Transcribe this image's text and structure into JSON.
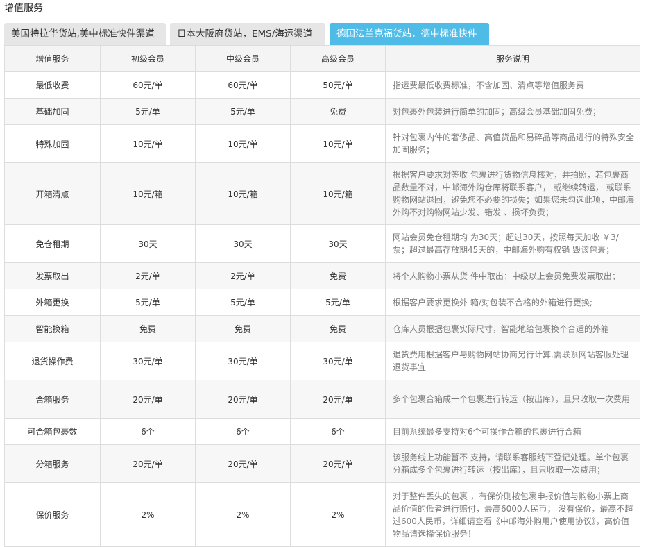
{
  "section": {
    "title": "增值服务"
  },
  "tabs": [
    {
      "label": "美国特拉华货站,美中标准快件渠道",
      "active": false
    },
    {
      "label": "日本大阪府货站，EMS/海运渠道",
      "active": false
    },
    {
      "label": "德国法兰克福货站，德中标准快件",
      "active": true
    }
  ],
  "colors": {
    "tab_active": "#4fbbe7",
    "tab_inactive": "#e6e6e6",
    "free_red": "#c8161d",
    "row_alt": "#f7f7f7",
    "header_bg": "#f4f4f4"
  },
  "table": {
    "headers": [
      "增值服务",
      "初级会员",
      "中级会员",
      "高级会员",
      "服务说明"
    ],
    "rows": [
      {
        "service": "最低收费",
        "basic": "60元/单",
        "mid": "60元/单",
        "senior": "50元/单",
        "desc": "指运费最低收费标准，不含加固、清点等增值服务费"
      },
      {
        "service": "基础加固",
        "basic": "5元/单",
        "mid": "5元/单",
        "senior": "免费",
        "desc": "对包裹外包装进行简单的加固；高级会员基础加固免费；"
      },
      {
        "service": "特殊加固",
        "basic": "10元/单",
        "mid": "10元/单",
        "senior": "10元/单",
        "desc": "针对包裹内件的奢侈品、高值货品和易碎品等商品进行的特殊安全加固服务；"
      },
      {
        "service": "开箱清点",
        "basic": "10元/箱",
        "mid": "10元/箱",
        "senior": "10元/箱",
        "desc": "根据客户要求对签收 包裹进行货物信息核对，并拍照，若包裹商品数量不对，中邮海外购仓库将联系客户， 或继续转运， 或联系购物网站退回，避免您不必要的损失；如果您未勾选此项，中邮海外购不对购物网站少发、错发 、损坏负责；"
      },
      {
        "service": "免仓租期",
        "basic": "30天",
        "mid": "30天",
        "senior": "30天",
        "desc": "网站会员免仓租期均 为30天；超过30天，按照每天加收 ￥3/票；超过最高存放期45天的，中邮海外购有权销 毁该包裹；"
      },
      {
        "service": "发票取出",
        "basic": "2元/单",
        "mid": "2元/单",
        "senior": "免费",
        "desc": "将个人购物小票从货 件中取出；中级以上会员免费发票取出；"
      },
      {
        "service": "外箱更换",
        "basic": "5元/单",
        "mid": "5元/单",
        "senior": "5元/单",
        "desc": "根据客户要求更换外 箱/对包装不合格的外箱进行更换;"
      },
      {
        "service": "智能换箱",
        "basic": "免费",
        "mid": "免费",
        "senior": "免费",
        "desc": "仓库人员根据包裹实际尺寸，智能地给包裹换个合适的外箱"
      },
      {
        "service": "退货操作费",
        "basic": "30元/单",
        "mid": "30元/单",
        "senior": "30元/单",
        "desc": "退货费用根据客户与购物网站协商另行计算,需联系网站客服处理退货事宜"
      },
      {
        "service": "合箱服务",
        "basic": "20元/单",
        "mid": "20元/单",
        "senior": "20元/单",
        "desc": "多个包裹合箱成一个包裹进行转运（按出库），且只收取一次费用"
      },
      {
        "service": "可合箱包裹数",
        "basic": "6个",
        "mid": "6个",
        "senior": "6个",
        "desc": "目前系统最多支持对6个可操作合箱的包裹进行合箱"
      },
      {
        "service": "分箱服务",
        "basic": "20元/单",
        "mid": "20元/单",
        "senior": "20元/单",
        "desc": "该服务线上功能暂不 支持，请联系客服线下登记处理。单个包裹分箱成多个包裹进行转运（按出库），且只收取一次费用；"
      },
      {
        "service": "保价服务",
        "basic": "2%",
        "mid": "2%",
        "senior": "2%",
        "desc": "对于整件丢失的包裹 ，有保价则按包裹申报价值与购物小票上商品价值的低者进行赔付，最高6000人民币； 没有保价，最高不超过600人民币，详细请查看《中邮海外购用户使用协议》，高价值物品请选择保价服务！"
      }
    ],
    "highlight": {
      "rows": [
        0,
        1,
        5,
        7
      ],
      "comment": ""
    }
  }
}
